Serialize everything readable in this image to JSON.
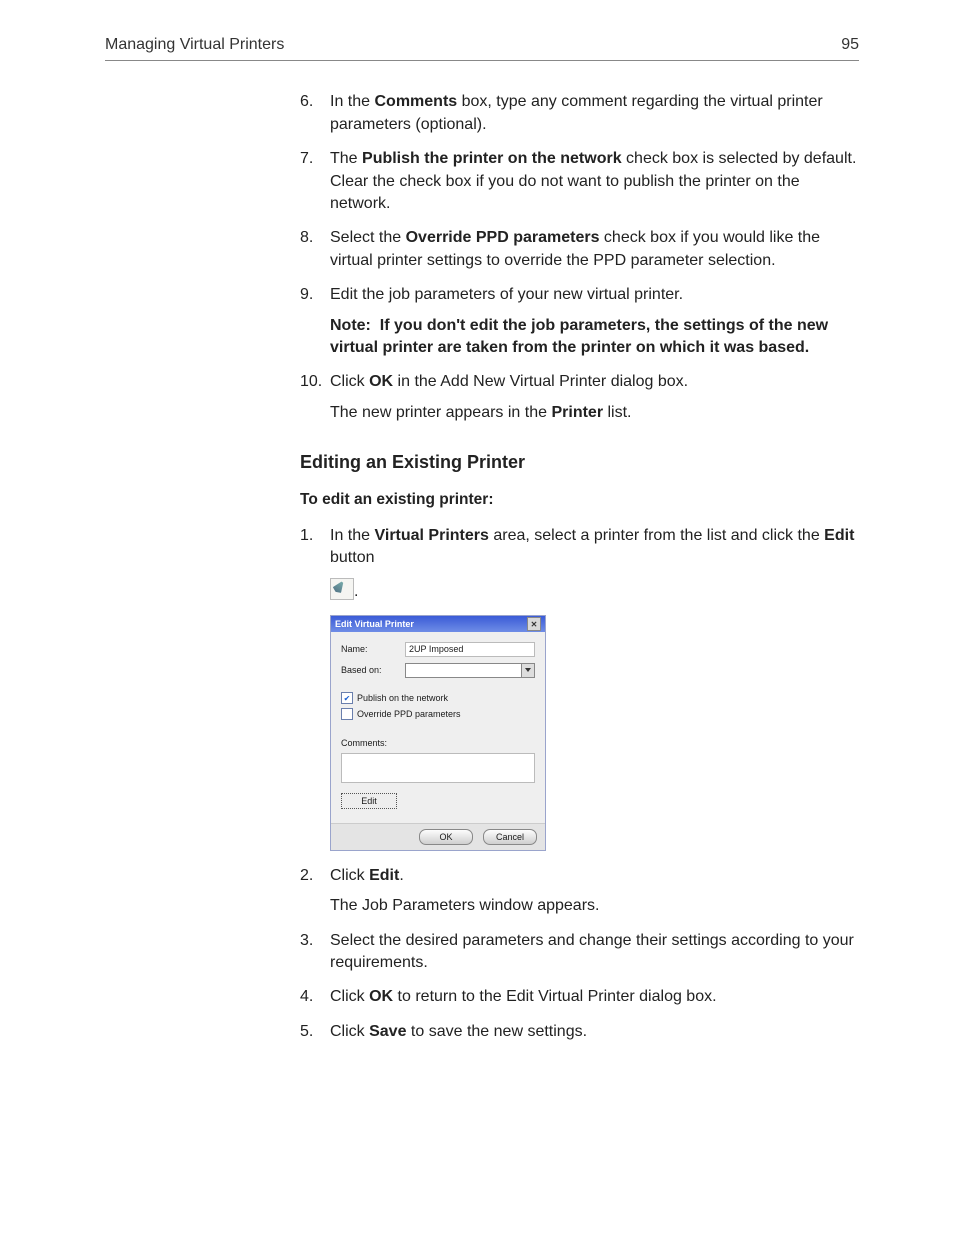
{
  "header": {
    "title": "Managing Virtual Printers",
    "page_number": "95"
  },
  "steps_top": [
    {
      "n": "6.",
      "pre": "In the ",
      "b": "Comments",
      "post": " box, type any comment regarding the virtual printer parameters (optional)."
    },
    {
      "n": "7.",
      "pre": "The ",
      "b": "Publish the printer on the network",
      "post": " check box is selected by default. Clear the check box if you do not want to publish the printer on the network."
    },
    {
      "n": "8.",
      "pre": "Select the ",
      "b": "Override PPD parameters",
      "post": " check box if you would like the virtual printer settings to override the PPD parameter selection."
    }
  ],
  "step9": {
    "n": "9.",
    "text": "Edit the job parameters of your new virtual printer.",
    "note_label": "Note:",
    "note_text": "If you don't edit the job parameters, the settings of the new virtual printer are taken from the printer on which it was based."
  },
  "step10": {
    "n": "10.",
    "pre": "Click ",
    "b": "OK",
    "post": " in the Add New Virtual Printer dialog box.",
    "result_pre": "The new printer appears in the ",
    "result_b": "Printer",
    "result_post": " list."
  },
  "section_heading": "Editing an Existing Printer",
  "sub_heading": "To edit an existing printer:",
  "edit_steps": {
    "s1": {
      "n": "1.",
      "pre": "In the ",
      "b": "Virtual Printers",
      "mid": " area, select a printer from the list and click the ",
      "b2": "Edit",
      "post": " button"
    },
    "s2": {
      "n": "2.",
      "pre": "Click ",
      "b": "Edit",
      "post": ".",
      "result": "The Job Parameters window appears."
    },
    "s3": {
      "n": "3.",
      "text": "Select the desired parameters and change their settings according to your requirements."
    },
    "s4": {
      "n": "4.",
      "pre": "Click ",
      "b": "OK",
      "post": " to return to the Edit Virtual Printer dialog box."
    },
    "s5": {
      "n": "5.",
      "pre": "Click ",
      "b": "Save",
      "post": " to save the new settings."
    }
  },
  "dialog": {
    "title": "Edit Virtual Printer",
    "name_label": "Name:",
    "name_value": "2UP Imposed",
    "based_label": "Based on:",
    "publish_label": "Publish on the network",
    "override_label": "Override PPD parameters",
    "comments_label": "Comments:",
    "edit_btn": "Edit",
    "ok_btn": "OK",
    "cancel_btn": "Cancel"
  }
}
